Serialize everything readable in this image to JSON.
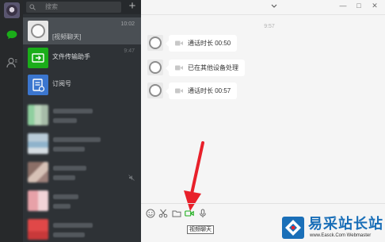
{
  "search": {
    "placeholder": "搜索"
  },
  "sessions": [
    {
      "title": "[视频聊天]",
      "time": "10:02"
    },
    {
      "title": "文件传输助手",
      "time": "9:47"
    },
    {
      "title": "订阅号",
      "time": ""
    }
  ],
  "chat": {
    "timestamp": "9:57",
    "messages": [
      {
        "text": "通话时长 00:50",
        "icon": "video-camera-icon"
      },
      {
        "text": "已在其他设备处理",
        "icon": "video-camera-icon"
      },
      {
        "text": "通话时长 00:57",
        "icon": "video-camera-icon"
      }
    ]
  },
  "toolbar": {
    "tooltip": "视频聊天",
    "icons": [
      "emoji-icon",
      "scissors-icon",
      "folder-icon",
      "video-call-icon",
      "voice-icon"
    ]
  },
  "colors": {
    "accent_green": "#1aad19",
    "sidebar_dark": "#27292b",
    "list_dark": "#2e3236",
    "arrow_red": "#e8202a",
    "watermark_blue": "#1a6fb8"
  },
  "watermark": {
    "title": "易采站长站",
    "subtitle": "www.Easck.Com   Webmaster"
  }
}
